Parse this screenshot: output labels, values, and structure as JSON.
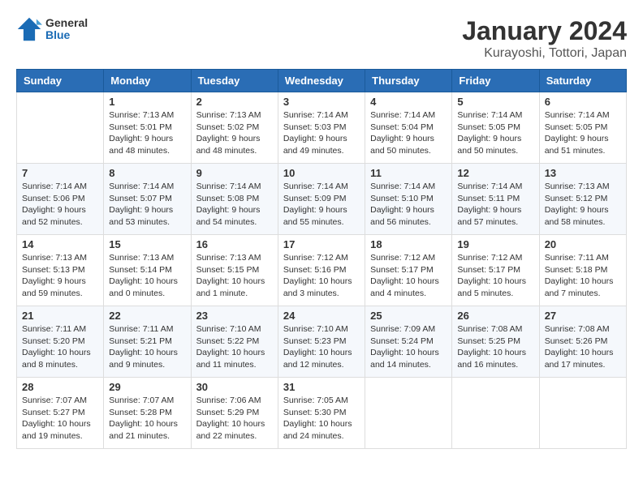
{
  "logo": {
    "general": "General",
    "blue": "Blue"
  },
  "title": "January 2024",
  "subtitle": "Kurayoshi, Tottori, Japan",
  "weekdays": [
    "Sunday",
    "Monday",
    "Tuesday",
    "Wednesday",
    "Thursday",
    "Friday",
    "Saturday"
  ],
  "weeks": [
    [
      {
        "day": "",
        "info": ""
      },
      {
        "day": "1",
        "info": "Sunrise: 7:13 AM\nSunset: 5:01 PM\nDaylight: 9 hours\nand 48 minutes."
      },
      {
        "day": "2",
        "info": "Sunrise: 7:13 AM\nSunset: 5:02 PM\nDaylight: 9 hours\nand 48 minutes."
      },
      {
        "day": "3",
        "info": "Sunrise: 7:14 AM\nSunset: 5:03 PM\nDaylight: 9 hours\nand 49 minutes."
      },
      {
        "day": "4",
        "info": "Sunrise: 7:14 AM\nSunset: 5:04 PM\nDaylight: 9 hours\nand 50 minutes."
      },
      {
        "day": "5",
        "info": "Sunrise: 7:14 AM\nSunset: 5:05 PM\nDaylight: 9 hours\nand 50 minutes."
      },
      {
        "day": "6",
        "info": "Sunrise: 7:14 AM\nSunset: 5:05 PM\nDaylight: 9 hours\nand 51 minutes."
      }
    ],
    [
      {
        "day": "7",
        "info": "Sunrise: 7:14 AM\nSunset: 5:06 PM\nDaylight: 9 hours\nand 52 minutes."
      },
      {
        "day": "8",
        "info": "Sunrise: 7:14 AM\nSunset: 5:07 PM\nDaylight: 9 hours\nand 53 minutes."
      },
      {
        "day": "9",
        "info": "Sunrise: 7:14 AM\nSunset: 5:08 PM\nDaylight: 9 hours\nand 54 minutes."
      },
      {
        "day": "10",
        "info": "Sunrise: 7:14 AM\nSunset: 5:09 PM\nDaylight: 9 hours\nand 55 minutes."
      },
      {
        "day": "11",
        "info": "Sunrise: 7:14 AM\nSunset: 5:10 PM\nDaylight: 9 hours\nand 56 minutes."
      },
      {
        "day": "12",
        "info": "Sunrise: 7:14 AM\nSunset: 5:11 PM\nDaylight: 9 hours\nand 57 minutes."
      },
      {
        "day": "13",
        "info": "Sunrise: 7:13 AM\nSunset: 5:12 PM\nDaylight: 9 hours\nand 58 minutes."
      }
    ],
    [
      {
        "day": "14",
        "info": "Sunrise: 7:13 AM\nSunset: 5:13 PM\nDaylight: 9 hours\nand 59 minutes."
      },
      {
        "day": "15",
        "info": "Sunrise: 7:13 AM\nSunset: 5:14 PM\nDaylight: 10 hours\nand 0 minutes."
      },
      {
        "day": "16",
        "info": "Sunrise: 7:13 AM\nSunset: 5:15 PM\nDaylight: 10 hours\nand 1 minute."
      },
      {
        "day": "17",
        "info": "Sunrise: 7:12 AM\nSunset: 5:16 PM\nDaylight: 10 hours\nand 3 minutes."
      },
      {
        "day": "18",
        "info": "Sunrise: 7:12 AM\nSunset: 5:17 PM\nDaylight: 10 hours\nand 4 minutes."
      },
      {
        "day": "19",
        "info": "Sunrise: 7:12 AM\nSunset: 5:17 PM\nDaylight: 10 hours\nand 5 minutes."
      },
      {
        "day": "20",
        "info": "Sunrise: 7:11 AM\nSunset: 5:18 PM\nDaylight: 10 hours\nand 7 minutes."
      }
    ],
    [
      {
        "day": "21",
        "info": "Sunrise: 7:11 AM\nSunset: 5:20 PM\nDaylight: 10 hours\nand 8 minutes."
      },
      {
        "day": "22",
        "info": "Sunrise: 7:11 AM\nSunset: 5:21 PM\nDaylight: 10 hours\nand 9 minutes."
      },
      {
        "day": "23",
        "info": "Sunrise: 7:10 AM\nSunset: 5:22 PM\nDaylight: 10 hours\nand 11 minutes."
      },
      {
        "day": "24",
        "info": "Sunrise: 7:10 AM\nSunset: 5:23 PM\nDaylight: 10 hours\nand 12 minutes."
      },
      {
        "day": "25",
        "info": "Sunrise: 7:09 AM\nSunset: 5:24 PM\nDaylight: 10 hours\nand 14 minutes."
      },
      {
        "day": "26",
        "info": "Sunrise: 7:08 AM\nSunset: 5:25 PM\nDaylight: 10 hours\nand 16 minutes."
      },
      {
        "day": "27",
        "info": "Sunrise: 7:08 AM\nSunset: 5:26 PM\nDaylight: 10 hours\nand 17 minutes."
      }
    ],
    [
      {
        "day": "28",
        "info": "Sunrise: 7:07 AM\nSunset: 5:27 PM\nDaylight: 10 hours\nand 19 minutes."
      },
      {
        "day": "29",
        "info": "Sunrise: 7:07 AM\nSunset: 5:28 PM\nDaylight: 10 hours\nand 21 minutes."
      },
      {
        "day": "30",
        "info": "Sunrise: 7:06 AM\nSunset: 5:29 PM\nDaylight: 10 hours\nand 22 minutes."
      },
      {
        "day": "31",
        "info": "Sunrise: 7:05 AM\nSunset: 5:30 PM\nDaylight: 10 hours\nand 24 minutes."
      },
      {
        "day": "",
        "info": ""
      },
      {
        "day": "",
        "info": ""
      },
      {
        "day": "",
        "info": ""
      }
    ]
  ]
}
